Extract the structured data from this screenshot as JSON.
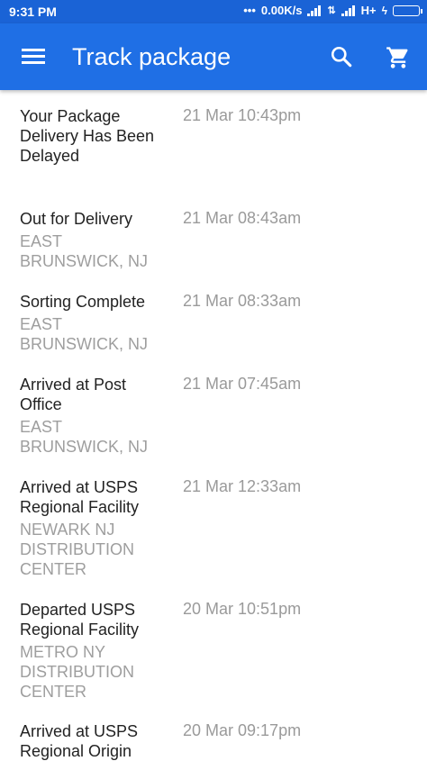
{
  "statusbar": {
    "time": "9:31 PM",
    "dots": "•••",
    "speed": "0.00K/s",
    "network": "H+"
  },
  "appbar": {
    "title": "Track package",
    "menu_icon": "menu-icon",
    "search_icon": "search-icon",
    "cart_icon": "cart-icon"
  },
  "events": [
    {
      "status": "Your Package Delivery Has Been Delayed",
      "location": "",
      "date": "21 Mar 10:43pm"
    },
    {
      "status": "Out for Delivery",
      "location": "EAST BRUNSWICK, NJ",
      "date": "21 Mar 08:43am"
    },
    {
      "status": "Sorting Complete",
      "location": "EAST BRUNSWICK, NJ",
      "date": "21 Mar 08:33am"
    },
    {
      "status": "Arrived at Post Office",
      "location": "EAST BRUNSWICK, NJ",
      "date": "21 Mar 07:45am"
    },
    {
      "status": "Arrived at USPS Regional Facility",
      "location": "NEWARK NJ DISTRIBUTION CENTER",
      "date": "21 Mar 12:33am"
    },
    {
      "status": "Departed USPS Regional Facility",
      "location": "METRO NY DISTRIBUTION CENTER",
      "date": "20 Mar 10:51pm"
    },
    {
      "status": "Arrived at USPS Regional Origin",
      "location": "",
      "date": "20 Mar 09:17pm"
    }
  ]
}
